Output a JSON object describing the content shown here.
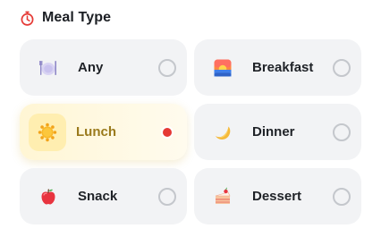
{
  "section": {
    "title": "Meal Type",
    "icon": "stopwatch-icon",
    "accent_color": "#e53935"
  },
  "options": [
    {
      "label": "Any",
      "icon": "fork-knife-plate-icon",
      "selected": false
    },
    {
      "label": "Breakfast",
      "icon": "sunrise-icon",
      "selected": false
    },
    {
      "label": "Lunch",
      "icon": "sun-icon",
      "selected": true
    },
    {
      "label": "Dinner",
      "icon": "crescent-moon-icon",
      "selected": false
    },
    {
      "label": "Snack",
      "icon": "apple-icon",
      "selected": false
    },
    {
      "label": "Dessert",
      "icon": "cake-slice-icon",
      "selected": false
    }
  ],
  "colors": {
    "card_bg": "#f2f3f5",
    "selected_bg": "#fff6d4",
    "selected_text": "#9a7a1c",
    "radio_border": "#c4c7cc",
    "radio_selected": "#e53935"
  }
}
